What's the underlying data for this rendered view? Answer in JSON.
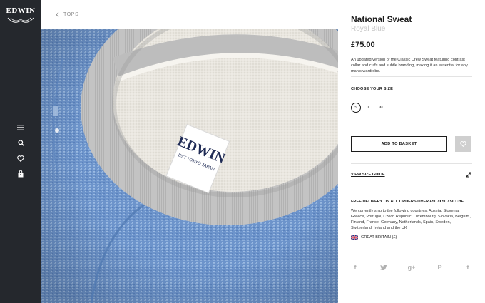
{
  "brand": {
    "logo_text": "EDWIN"
  },
  "rail": {
    "icons": [
      "menu-icon",
      "search-icon",
      "heart-icon",
      "bag-icon"
    ]
  },
  "breadcrumb": {
    "label": "TOPS"
  },
  "product": {
    "name": "National Sweat",
    "color": "Royal Blue",
    "price": "£75.00",
    "description": "An updated version of the Classic Crew Sweat featuring contrast collar and cuffs and subtle branding, making it an essential for any man's wardrobe.",
    "label_brand": "EDWIN",
    "label_tag": "EST TOKYO JAPAN"
  },
  "size_section": {
    "heading": "CHOOSE YOUR SIZE",
    "options": [
      "S",
      "L",
      "XL"
    ],
    "selected": "S"
  },
  "actions": {
    "add_to_basket": "ADD TO BASKET",
    "size_guide": "VIEW SIZE GUIDE"
  },
  "delivery": {
    "heading": "FREE DELIVERY ON ALL ORDERS OVER £50 / €50 / 50 CHF",
    "text": "We currently ship to the following countries: Austria, Slovenia, Greece, Portugal, Czech Republic, Luxembourg, Slovakia, Belgium, Finland, France, Germany, Netherlands, Spain, Sweden, Switzerland, Ireland and the UK",
    "country": "GREAT BRITAIN (£)"
  },
  "social": {
    "icons": [
      "facebook-icon",
      "twitter-icon",
      "google-plus-icon",
      "pinterest-icon",
      "tumblr-icon"
    ],
    "glyphs": [
      "f",
      "t",
      "g+",
      "P",
      "t"
    ]
  },
  "colors": {
    "rail": "#25282d",
    "sweat_blue": "#6f97cc",
    "collar_grey": "#c4c4c4",
    "muted_text": "#c6c6c6"
  }
}
